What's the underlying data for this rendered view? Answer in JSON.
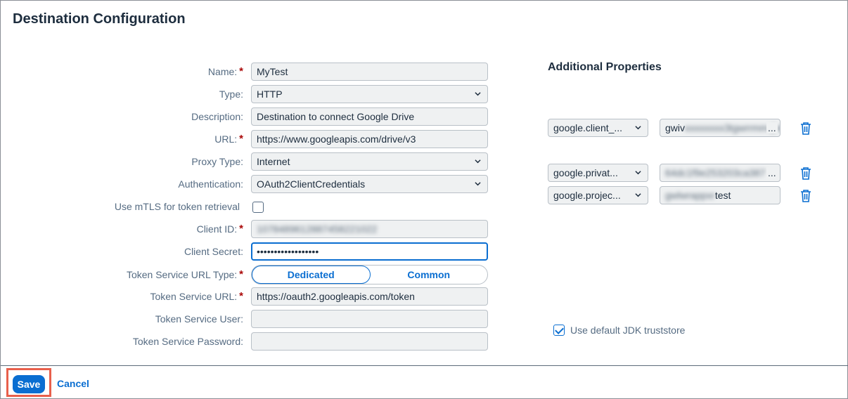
{
  "title": "Destination Configuration",
  "form": {
    "name": {
      "label": "Name:",
      "required": "*",
      "value": "MyTest"
    },
    "type": {
      "label": "Type:",
      "value": "HTTP"
    },
    "description": {
      "label": "Description:",
      "value": "Destination to connect Google Drive"
    },
    "url": {
      "label": "URL:",
      "required": "*",
      "value": "https://www.googleapis.com/drive/v3"
    },
    "proxy_type": {
      "label": "Proxy Type:",
      "value": "Internet"
    },
    "authentication": {
      "label": "Authentication:",
      "value": "OAuth2ClientCredentials"
    },
    "mtls": {
      "label": "Use mTLS for token retrieval",
      "checked": false
    },
    "client_id": {
      "label": "Client ID:",
      "required": "*",
      "value": "1078489612887458221022"
    },
    "client_secret": {
      "label": "Client Secret:",
      "value": "••••••••••••••••••"
    },
    "token_service_url_type": {
      "label": "Token Service URL Type:",
      "required": "*",
      "options": [
        "Dedicated",
        "Common"
      ],
      "selected": "Dedicated"
    },
    "token_service_url": {
      "label": "Token Service URL:",
      "required": "*",
      "value": "https://oauth2.googleapis.com/token"
    },
    "token_service_user": {
      "label": "Token Service User:",
      "value": ""
    },
    "token_service_password": {
      "label": "Token Service Password:",
      "value": ""
    }
  },
  "additional_properties": {
    "title": "Additional Properties",
    "items": [
      {
        "key": "google.client_...",
        "value_prefix": "gwiv",
        "value_blurred": "xxxxxxxx3tgwrrmm@ex",
        "value_suffix": "..."
      },
      {
        "key": "google.privat...",
        "value_blurred": "64dc1f9e253203ca387",
        "value_suffix": "..."
      },
      {
        "key": "google.projec...",
        "value_blurred": "gwlwrappxr",
        "value_suffix": "test"
      }
    ]
  },
  "jdk_truststore": {
    "label": "Use default JDK truststore",
    "checked": true
  },
  "footer": {
    "save_label": "Save",
    "cancel_label": "Cancel"
  },
  "colors": {
    "accent": "#0a6ed1",
    "required": "#aa0808",
    "highlight": "#e8604c",
    "label": "#556b82"
  }
}
